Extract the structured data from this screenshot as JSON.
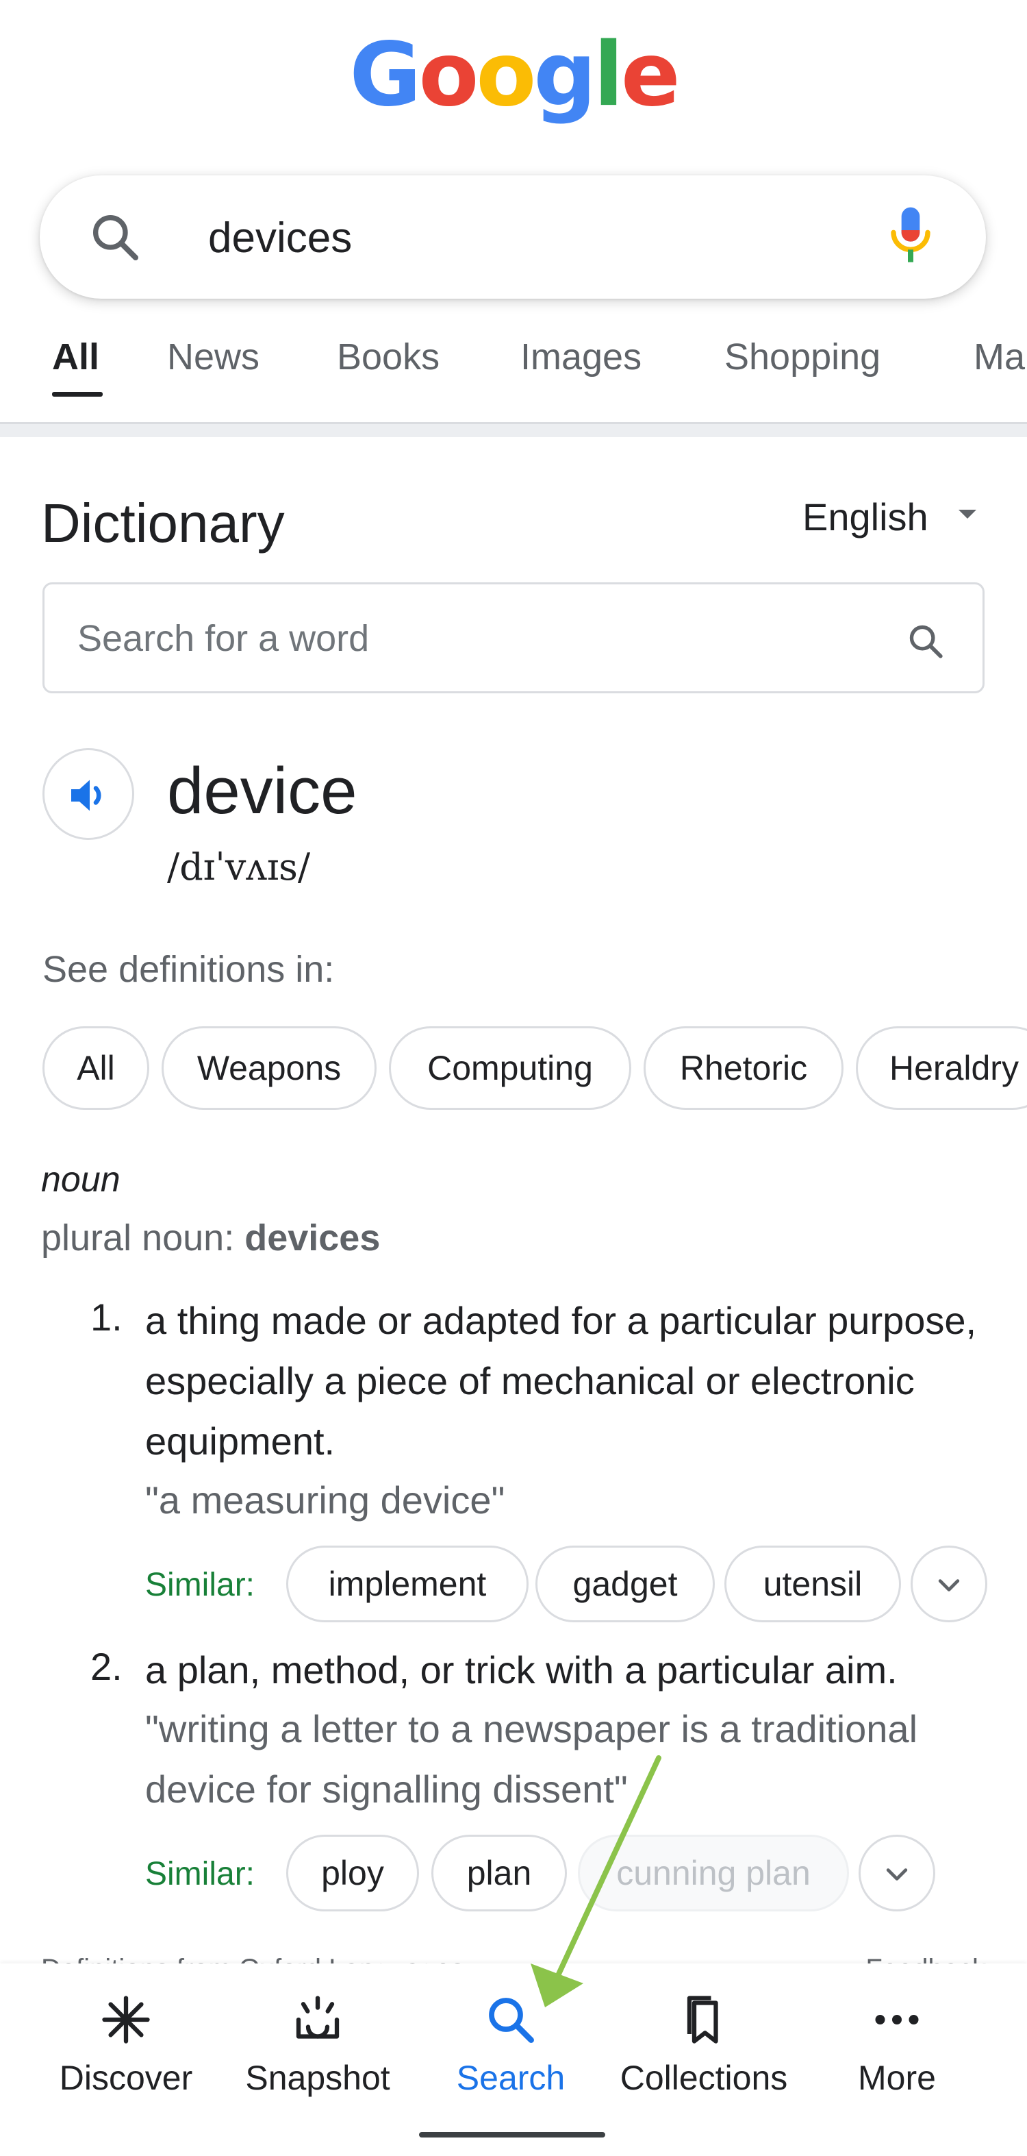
{
  "logo": {
    "letters": [
      "G",
      "o",
      "o",
      "g",
      "l",
      "e"
    ],
    "colors": [
      "#4285F4",
      "#EA4335",
      "#FBBC05",
      "#4285F4",
      "#34A853",
      "#EA4335"
    ]
  },
  "search": {
    "query": "devices",
    "search_icon": "search-icon",
    "mic_icon": "mic-icon"
  },
  "tabs": [
    "All",
    "News",
    "Books",
    "Images",
    "Shopping",
    "Ma"
  ],
  "tabs_active": "All",
  "dictionary": {
    "title": "Dictionary",
    "language": "English",
    "word_search_placeholder": "Search for a word",
    "word": "device",
    "phonetic": "/dɪˈvʌɪs/",
    "see_definitions_label": "See definitions in:",
    "domains": [
      "All",
      "Weapons",
      "Computing",
      "Rhetoric",
      "Heraldry"
    ],
    "part_of_speech": "noun",
    "plural_label": "plural noun: ",
    "plural_value": "devices",
    "definitions": [
      {
        "number": "1.",
        "text": "a thing made or adapted for a particular purpose, especially a piece of mechanical or electronic equipment.",
        "example": "\"a measuring device\"",
        "similar_label": "Similar:",
        "similar": [
          "implement",
          "gadget",
          "utensil"
        ]
      },
      {
        "number": "2.",
        "text": "a plan, method, or trick with a particular aim.",
        "example": "\"writing a letter to a newspaper is a traditional device for signalling dissent\"",
        "similar_label": "Similar:",
        "similar": [
          "ploy",
          "plan",
          "cunning plan"
        ]
      }
    ],
    "source": "Definitions from Oxford Languages",
    "feedback": "Feedback"
  },
  "bottom_nav": {
    "items": [
      {
        "label": "Discover",
        "icon": "asterisk-icon"
      },
      {
        "label": "Snapshot",
        "icon": "snapshot-icon"
      },
      {
        "label": "Search",
        "icon": "search-icon"
      },
      {
        "label": "Collections",
        "icon": "bookmarks-icon"
      },
      {
        "label": "More",
        "icon": "more-dots-icon"
      }
    ],
    "active": "Search"
  },
  "colors": {
    "accent_blue": "#1a73e8",
    "similar_green": "#188038",
    "annotation_arrow": "#8bc34a"
  }
}
